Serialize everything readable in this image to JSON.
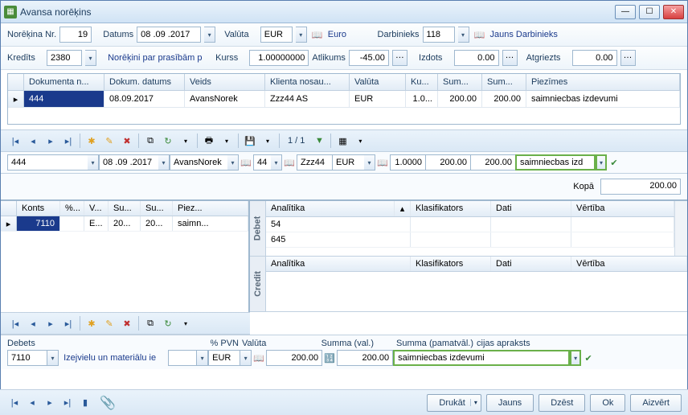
{
  "window": {
    "title": "Avansa norēķins"
  },
  "header": {
    "norNr_lbl": "Norēķina Nr.",
    "norNr": "19",
    "datums_lbl": "Datums",
    "datums": "08 .09 .2017",
    "valuta_lbl": "Valūta",
    "valuta": "EUR",
    "valuta_name": "Euro",
    "darb_lbl": "Darbinieks",
    "darb": "118",
    "darb_name": "Jauns Darbinieks",
    "kredits_lbl": "Kredīts",
    "kredits": "2380",
    "kredits_name": "Norēķini par prasībām p",
    "kurss_lbl": "Kurss",
    "kurss": "1.00000000",
    "atlik_lbl": "Atlikums",
    "atlik": "-45.00",
    "izdots_lbl": "Izdots",
    "izdots": "0.00",
    "atgr_lbl": "Atgriezts",
    "atgr": "0.00"
  },
  "grid": {
    "cols": [
      "Dokumenta n...",
      "Dokum. datums",
      "Veids",
      "Klienta nosau...",
      "Valūta",
      "Ku...",
      "Sum...",
      "Sum...",
      "Piezīmes"
    ],
    "row": {
      "nr": "444",
      "dat": "08.09.2017",
      "veids": "AvansNorek",
      "klient": "Zzz44 AS",
      "val": "EUR",
      "ku": "1.0...",
      "s1": "200.00",
      "s2": "200.00",
      "piez": "saimniecbas izdevumi"
    }
  },
  "pager": "1 / 1",
  "edit": {
    "nr": "444",
    "dat": "08 .09 .2017",
    "veids": "AvansNorek",
    "kl_code": "44",
    "kl": "Zzz44",
    "val": "EUR",
    "ku": "1.0000",
    "s1": "200.00",
    "s2": "200.00",
    "piez": "saimniecbas izd"
  },
  "total": {
    "lbl": "Kopā",
    "val": "200.00"
  },
  "left_grid": {
    "cols": [
      "Konts",
      "%...",
      "V...",
      "Su...",
      "Su...",
      "Piez..."
    ],
    "row": {
      "konts": "7110",
      "p": "",
      "v": "E...",
      "s1": "20...",
      "s2": "20...",
      "piez": "saimn..."
    }
  },
  "dc": {
    "debet": "Debet",
    "credit": "Credit",
    "cols": [
      "Analītika",
      "Klasifikators",
      "Dati",
      "Vērtība"
    ],
    "debet_rows": [
      "54",
      "645"
    ]
  },
  "bottom": {
    "debets_lbl": "Debets",
    "debets": "7110",
    "pvn_lbl": "% PVN",
    "izej": "Izejvielu un materiālu ie",
    "val_lbl": "Valūta",
    "val": "EUR",
    "sumv_lbl": "Summa (val.)",
    "sumv": "200.00",
    "sump_lbl": "Summa (pamatvāl.)",
    "sump": "200.00",
    "apr_lbl": "cijas apraksts",
    "apr": "saimniecbas izdevumi"
  },
  "footer": {
    "drukat": "Drukāt",
    "jauns": "Jauns",
    "dzest": "Dzēst",
    "ok": "Ok",
    "aizvert": "Aizvērt"
  }
}
